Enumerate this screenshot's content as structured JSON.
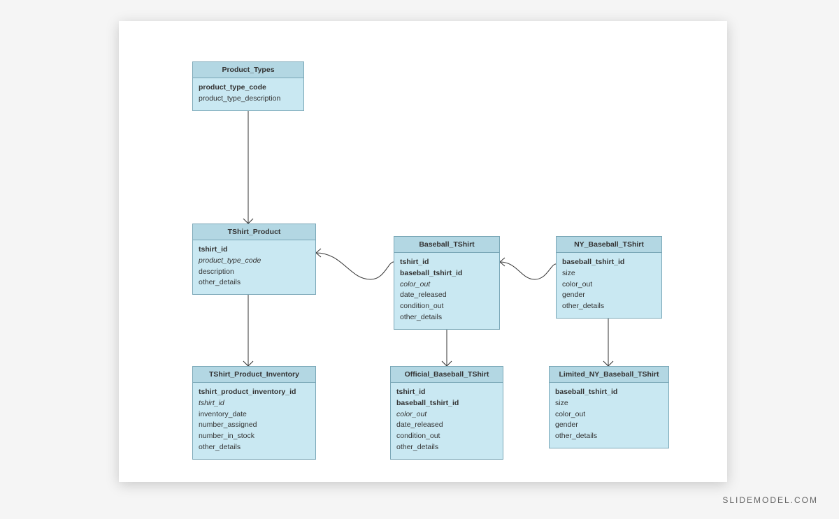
{
  "watermark": "SLIDEMODEL.COM",
  "entities": {
    "product_types": {
      "title": "Product_Types",
      "attrs": [
        {
          "text": "product_type_code",
          "key": true
        },
        {
          "text": "product_type_description"
        }
      ]
    },
    "tshirt_product": {
      "title": "TShirt_Product",
      "attrs": [
        {
          "text": "tshirt_id",
          "key": true
        },
        {
          "text": "product_type_code",
          "fk": true
        },
        {
          "text": "description"
        },
        {
          "text": "other_details"
        }
      ]
    },
    "baseball_tshirt": {
      "title": "Baseball_TShirt",
      "attrs": [
        {
          "text": "tshirt_id",
          "key": true
        },
        {
          "text": "baseball_tshirt_id",
          "key": true
        },
        {
          "text": "color_out",
          "fk": true
        },
        {
          "text": "date_released"
        },
        {
          "text": "condition_out"
        },
        {
          "text": "other_details"
        }
      ]
    },
    "ny_baseball_tshirt": {
      "title": "NY_Baseball_TShirt",
      "attrs": [
        {
          "text": "baseball_tshirt_id",
          "key": true
        },
        {
          "text": "size"
        },
        {
          "text": "color_out"
        },
        {
          "text": "gender"
        },
        {
          "text": "other_details"
        }
      ]
    },
    "tshirt_product_inventory": {
      "title": "TShirt_Product_Inventory",
      "attrs": [
        {
          "text": "tshirt_product_inventory_id",
          "key": true
        },
        {
          "text": "tshirt_id",
          "fk": true
        },
        {
          "text": "inventory_date"
        },
        {
          "text": "number_assigned"
        },
        {
          "text": "number_in_stock"
        },
        {
          "text": "other_details"
        }
      ]
    },
    "official_baseball_tshirt": {
      "title": "Official_Baseball_TShirt",
      "attrs": [
        {
          "text": "tshirt_id",
          "key": true
        },
        {
          "text": "baseball_tshirt_id",
          "key": true
        },
        {
          "text": "color_out",
          "fk": true
        },
        {
          "text": "date_released"
        },
        {
          "text": "condition_out"
        },
        {
          "text": "other_details"
        }
      ]
    },
    "limited_ny_baseball_tshirt": {
      "title": "Limited_NY_Baseball_TShirt",
      "attrs": [
        {
          "text": "baseball_tshirt_id",
          "key": true
        },
        {
          "text": "size"
        },
        {
          "text": "color_out"
        },
        {
          "text": "gender"
        },
        {
          "text": "other_details"
        }
      ]
    }
  }
}
